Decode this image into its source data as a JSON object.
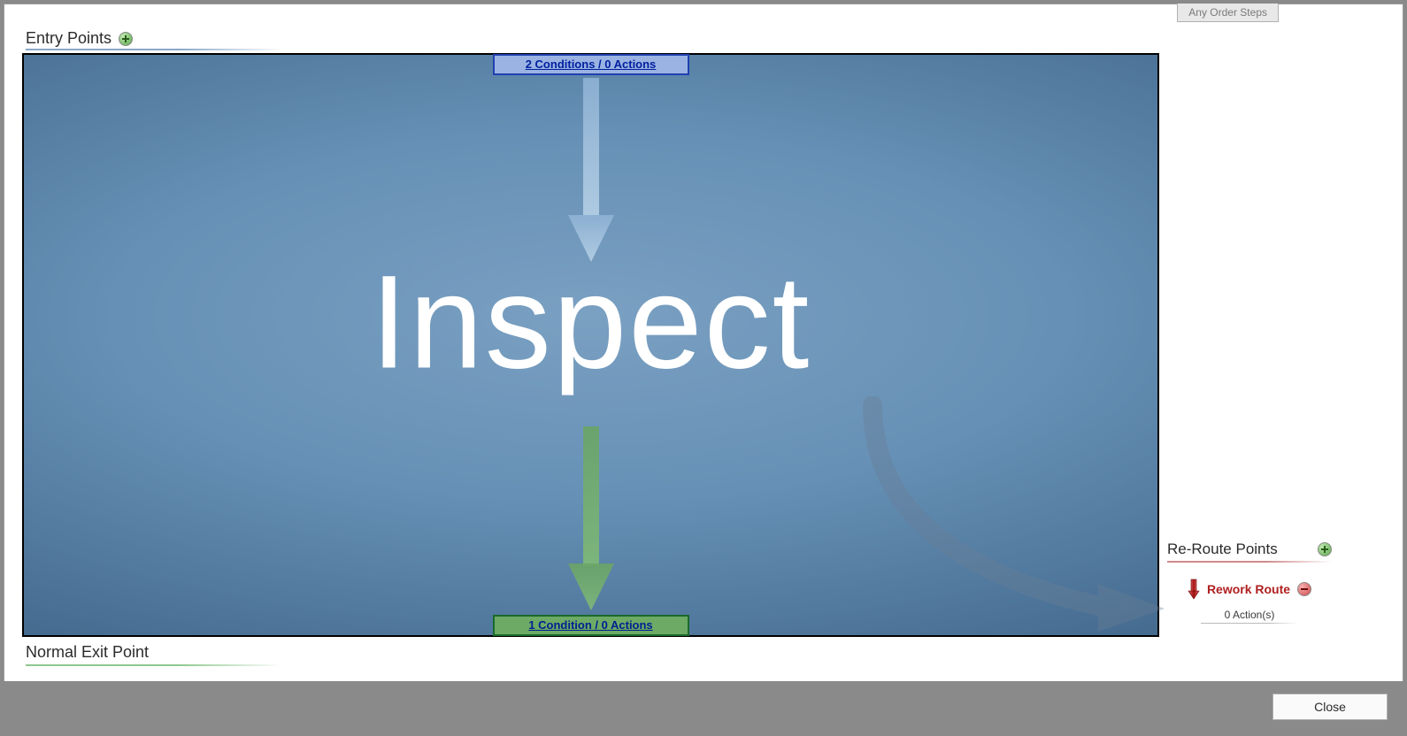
{
  "tabs": {
    "any_order_steps": "Any Order Steps"
  },
  "entry": {
    "label": "Entry Points",
    "badge": "2 Conditions /  0 Actions"
  },
  "node": {
    "title": "Inspect"
  },
  "exit": {
    "label": "Normal Exit Point",
    "badge": "1 Condition /  0 Actions"
  },
  "reroute": {
    "header": "Re-Route Points",
    "item_label": "Rework Route",
    "actions_text": "0  Action(s)"
  },
  "buttons": {
    "close": "Close"
  },
  "colors": {
    "entry_badge_border": "#2040b0",
    "entry_badge_bg": "#9ab3e2",
    "exit_badge_border": "#1a6a2a",
    "exit_badge_bg": "#6daa66",
    "reroute_text": "#b02020"
  }
}
